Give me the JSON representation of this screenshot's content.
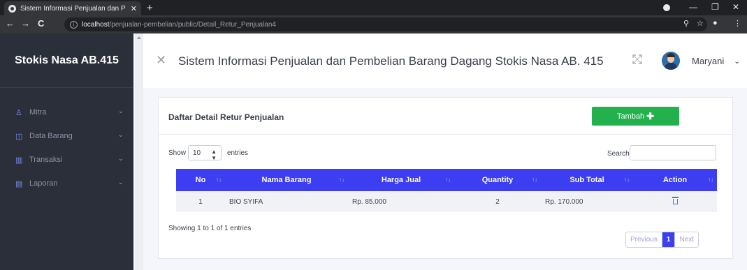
{
  "browser": {
    "tab_title": "Sistem Informasi Penjualan dan P",
    "url_host": "localhost",
    "url_path": "/penjualan-pembelian/public/Detail_Retur_Penjualan4"
  },
  "sidebar": {
    "brand": "Stokis Nasa AB.415",
    "items": [
      {
        "label": "Mitra",
        "icon": "user-icon"
      },
      {
        "label": "Data Barang",
        "icon": "box-icon"
      },
      {
        "label": "Transaksi",
        "icon": "chart-icon"
      },
      {
        "label": "Laporan",
        "icon": "report-icon"
      }
    ]
  },
  "header": {
    "title": "Sistem Informasi Penjualan dan Pembelian Barang Dagang Stokis Nasa AB. 415",
    "user_name": "Maryani"
  },
  "card": {
    "title": "Daftar Detail Retur Penjualan",
    "add_button": "Tambah"
  },
  "table_controls": {
    "show_label": "Show",
    "page_length": "10",
    "entries_label": "entries",
    "search_label": "Search:"
  },
  "table": {
    "columns": [
      "No",
      "Nama Barang",
      "Harga Jual",
      "Quantity",
      "Sub Total",
      "Action"
    ],
    "rows": [
      {
        "no": "1",
        "nama_barang": "BIO SYIFA",
        "harga_jual": "Rp. 85.000",
        "quantity": "2",
        "sub_total": "Rp. 170.000"
      }
    ]
  },
  "footer": {
    "info": "Showing 1 to 1 of 1 entries",
    "prev": "Previous",
    "current_page": "1",
    "next": "Next"
  },
  "colors": {
    "table_header": "#3d3df2",
    "add_button": "#22b14c",
    "sidebar": "#2b2f3a"
  }
}
